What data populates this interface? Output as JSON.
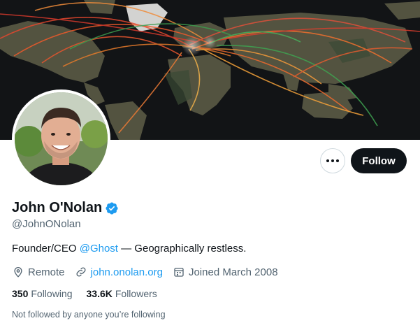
{
  "profile": {
    "display_name": "John O'Nolan",
    "handle": "@JohnONolan",
    "bio": {
      "prefix": "Founder/CEO ",
      "mention": "@Ghost",
      "suffix": " — Geographically restless."
    },
    "location": "Remote",
    "website": "john.onolan.org",
    "joined": "Joined March 2008",
    "following": {
      "count": "350",
      "label": "Following"
    },
    "followers": {
      "count": "33.6K",
      "label": "Followers"
    },
    "followed_note": "Not followed by anyone you’re following"
  },
  "actions": {
    "follow_label": "Follow"
  },
  "icons": {
    "more": "more-horizontal-icon",
    "verified": "verified-badge-icon",
    "location": "location-pin-icon",
    "website": "link-icon",
    "joined": "calendar-icon"
  },
  "colors": {
    "accent": "#1d9bf0",
    "text_primary": "#0f1419",
    "text_secondary": "#536471",
    "button_dark": "#0f1419"
  }
}
